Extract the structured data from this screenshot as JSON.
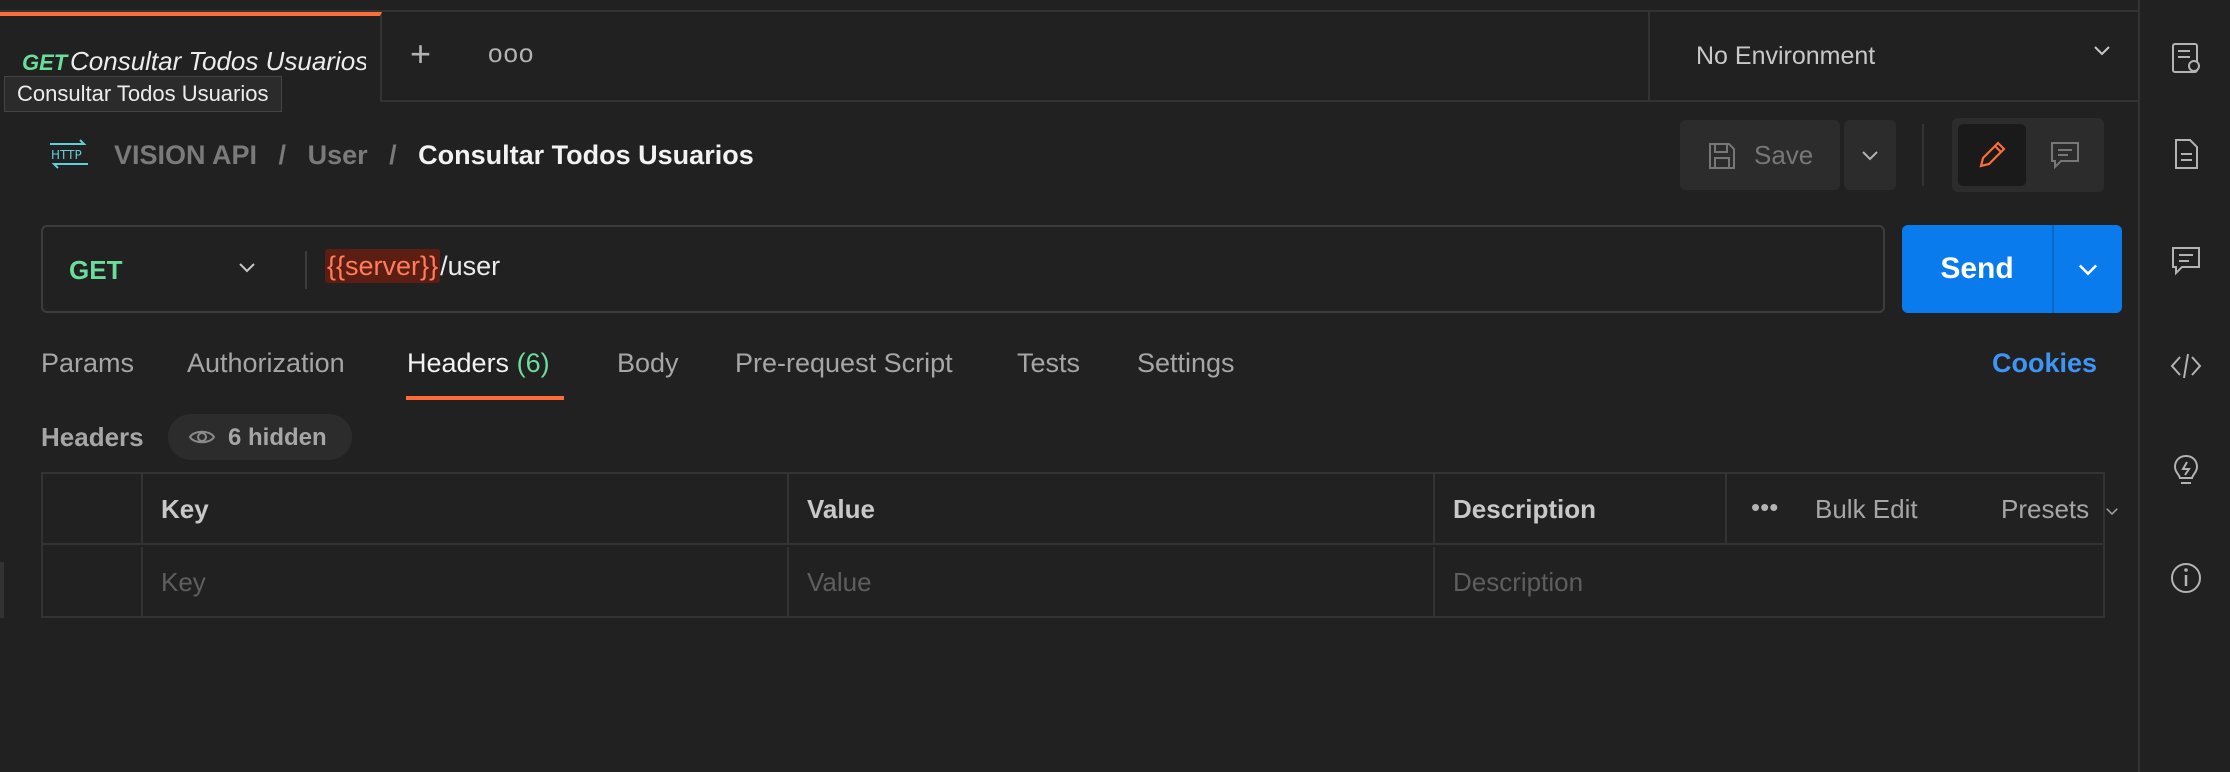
{
  "tab": {
    "method": "GET",
    "title": "Consultar Todos Usuarios",
    "tooltip": "Consultar Todos Usuarios",
    "more_label": "ooo"
  },
  "environment": {
    "selected": "No Environment"
  },
  "breadcrumb": {
    "collection": "VISION API",
    "folder": "User",
    "request": "Consultar Todos Usuarios",
    "separator": "/",
    "icon_text": "HTTP"
  },
  "toolbar": {
    "save_label": "Save"
  },
  "request": {
    "method": "GET",
    "url_variable": "{{server}}",
    "url_path": "/user",
    "send_label": "Send"
  },
  "request_tabs": [
    {
      "label": "Params"
    },
    {
      "label": "Authorization"
    },
    {
      "label": "Headers",
      "count": "(6)"
    },
    {
      "label": "Body"
    },
    {
      "label": "Pre-request Script"
    },
    {
      "label": "Tests"
    },
    {
      "label": "Settings"
    }
  ],
  "cookies_label": "Cookies",
  "headers_section": {
    "title": "Headers",
    "hidden_label": "6 hidden"
  },
  "headers_table": {
    "columns": [
      "Key",
      "Value",
      "Description"
    ],
    "placeholders": [
      "Key",
      "Value",
      "Description"
    ],
    "more_label": "•••",
    "bulk_edit_label": "Bulk Edit",
    "presets_label": "Presets"
  },
  "colors": {
    "accent": "#ff6c37",
    "method_get": "#6bdd9a",
    "send_button": "#097bed",
    "cookies_link": "#3f95f5",
    "variable_bg": "#5c1e12",
    "variable_text": "#ff7c5c"
  },
  "icons": {
    "right_rail": [
      "environment-quicklook-icon",
      "documentation-icon",
      "comments-icon",
      "code-icon",
      "lightbulb-icon",
      "info-icon"
    ]
  }
}
